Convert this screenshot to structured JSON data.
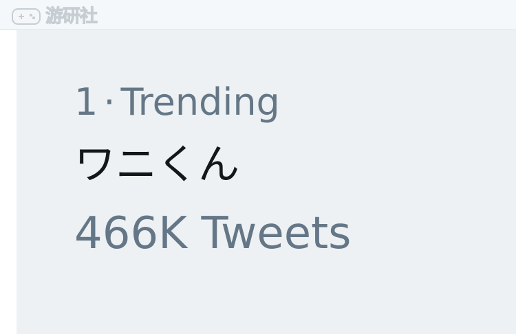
{
  "watermark": {
    "text": "游研社",
    "icon": "gamepad-icon"
  },
  "trend": {
    "rank": "1",
    "separator": "·",
    "context": "Trending",
    "name": "ワニくん",
    "tweet_count": "466K Tweets"
  },
  "colors": {
    "panel_background": "#edf1f4",
    "header_background": "#f5f8fa",
    "secondary_text": "#657786",
    "primary_text": "#14171a"
  }
}
